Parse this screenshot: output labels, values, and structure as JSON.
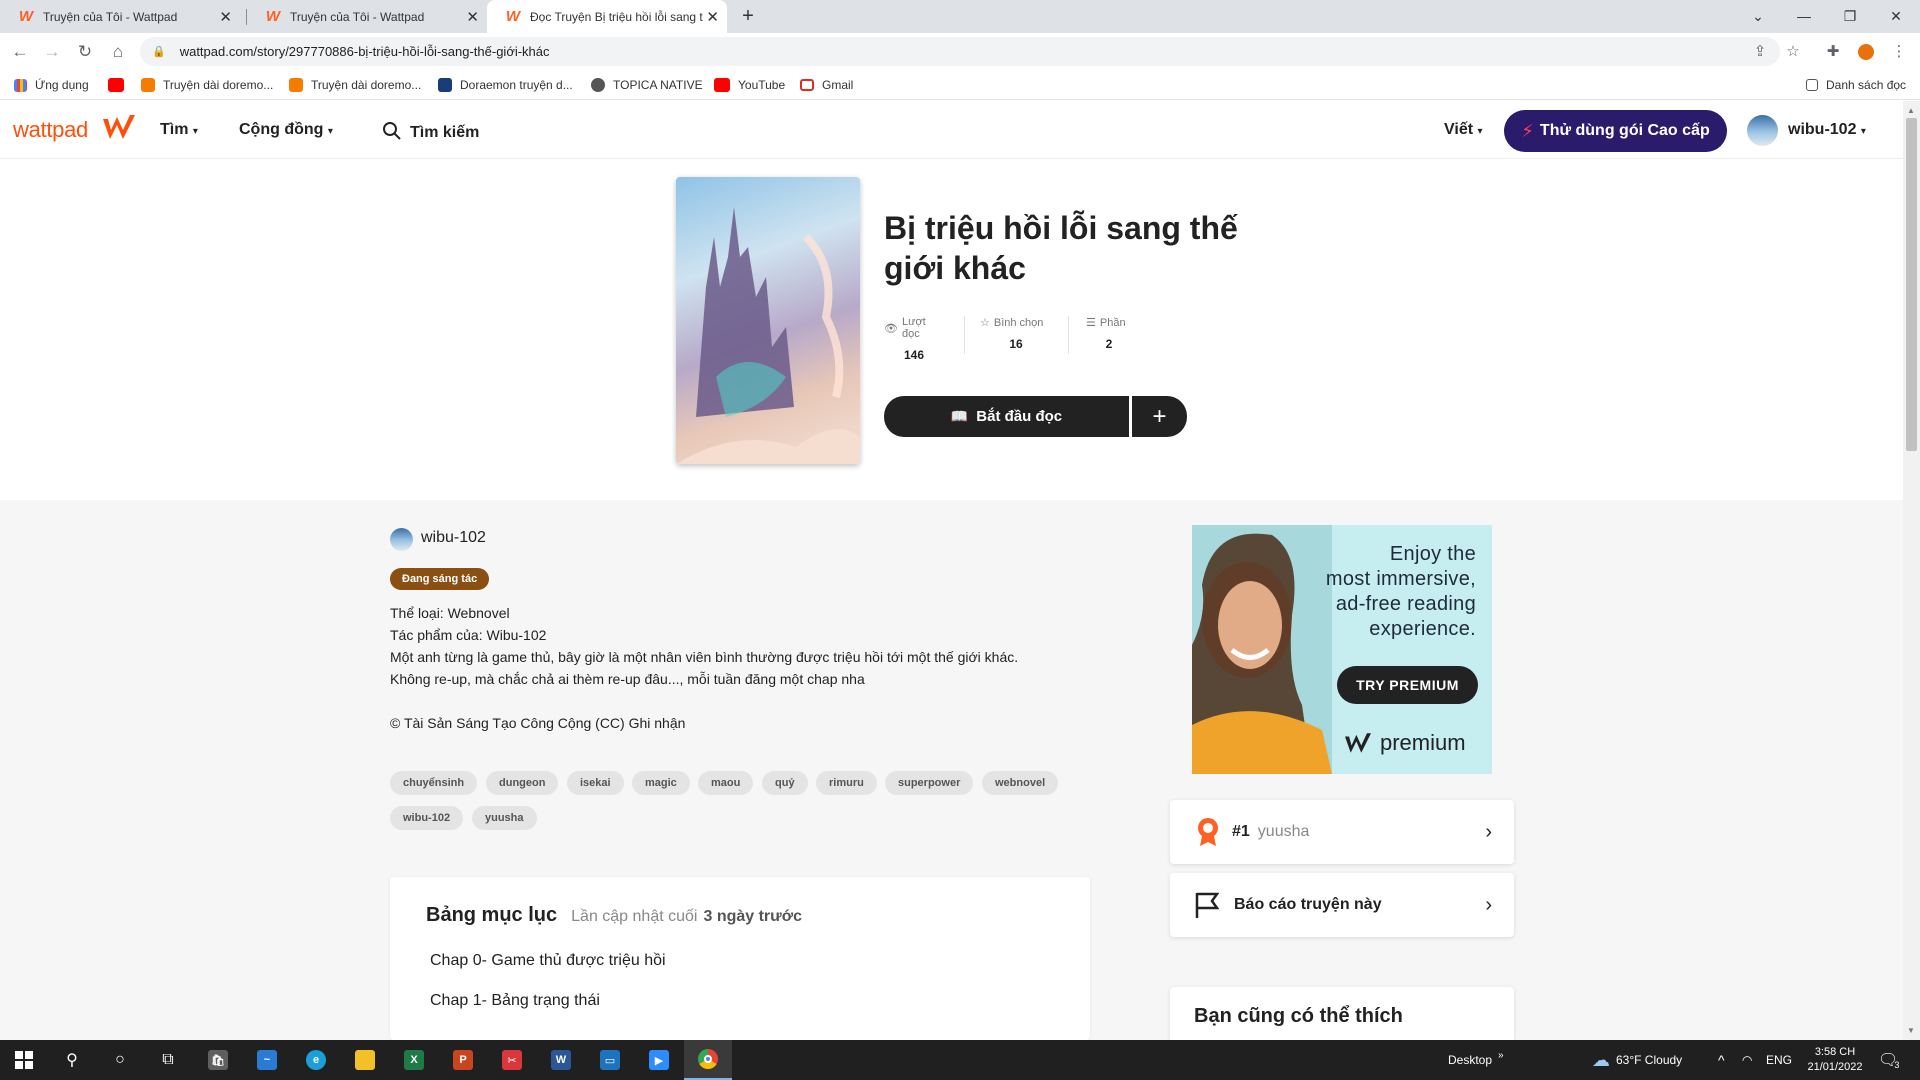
{
  "browser": {
    "tabs": [
      {
        "label": "Truyện của Tôi - Wattpad",
        "active": false
      },
      {
        "label": "Truyện của Tôi - Wattpad",
        "active": false
      },
      {
        "label": "Đọc Truyện Bị triệu hồi lỗi sang t",
        "active": true
      }
    ],
    "new_tab": "+",
    "url": "wattpad.com/story/297770886-bị-triệu-hồi-lỗi-sang-thế-giới-khác",
    "bookmarks": [
      {
        "label": "Ứng dụng",
        "color": "#4285f4"
      },
      {
        "label": "",
        "color": "#ff0000"
      },
      {
        "label": "Truyện dài doremo...",
        "color": "#f57c00"
      },
      {
        "label": "Truyện dài doremo...",
        "color": "#f57c00"
      },
      {
        "label": "Doraemon truyện d...",
        "color": "#1a3c7a"
      },
      {
        "label": "TOPICA NATIVE",
        "color": "#555555"
      },
      {
        "label": "YouTube",
        "color": "#ff0000"
      },
      {
        "label": "Gmail",
        "color": "#d93025"
      }
    ],
    "reading_list": "Danh sách đọc"
  },
  "header": {
    "logo": "wattpad",
    "nav": [
      "Tìm",
      "Cộng đồng"
    ],
    "search_label": "Tìm kiếm",
    "write": "Viết",
    "premium_cta": "Thử dùng gói Cao cấp",
    "username": "wibu-102",
    "brand_color": "#ff500a",
    "premium_color": "#2b1b6b"
  },
  "story": {
    "title": "Bị triệu hồi lỗi sang thế giới khác",
    "stats": [
      {
        "label": "Lượt đọc",
        "value": "146",
        "icon": "eye-icon"
      },
      {
        "label": "Bình chọn",
        "value": "16",
        "icon": "star-icon"
      },
      {
        "label": "Phần",
        "value": "2",
        "icon": "list-icon"
      }
    ],
    "start_reading": "Bắt đầu đọc",
    "add": "+",
    "author": "wibu-102",
    "status_badge": "Đang sáng tác",
    "genre": "Thể loại: Webnovel",
    "author_line": "Tác phẩm của: Wibu-102",
    "description_1": "Một anh từng là game thủ, bây giờ là một nhân viên bình thường được triệu hồi tới một thế giới khác.",
    "description_2": "Không re-up, mà chắc chả ai thèm re-up đâu..., mỗi tuần đăng một chap nha",
    "license": "© Tài Sản Sáng Tạo Công Cộng (CC) Ghi nhận",
    "tags": [
      "chuyểnsinh",
      "dungeon",
      "isekai",
      "magic",
      "maou",
      "quỷ",
      "rimuru",
      "superpower",
      "webnovel",
      "wibu-102",
      "yuusha"
    ]
  },
  "toc": {
    "heading": "Bảng mục lục",
    "updated_prefix": "Lần cập nhật cuối",
    "updated_value": "3 ngày trước",
    "chapters": [
      "Chap 0- Game thủ được triệu hồi",
      "Chap 1- Bảng trạng thái"
    ]
  },
  "ad": {
    "text_1": "Enjoy the",
    "text_2": "most immersive,",
    "text_3": "ad-free reading",
    "text_4": "experience.",
    "cta": "TRY PREMIUM",
    "brand": "premium"
  },
  "sidebar": {
    "rank_number": "#1",
    "rank_tag": "yuusha",
    "report": "Báo cáo truyện này",
    "recommend": "Bạn cũng có thể thích"
  },
  "taskbar": {
    "desktop": "Desktop",
    "weather": "63°F  Cloudy",
    "lang": "ENG",
    "time": "3:58 CH",
    "date": "21/01/2022",
    "notif_count": "3"
  }
}
